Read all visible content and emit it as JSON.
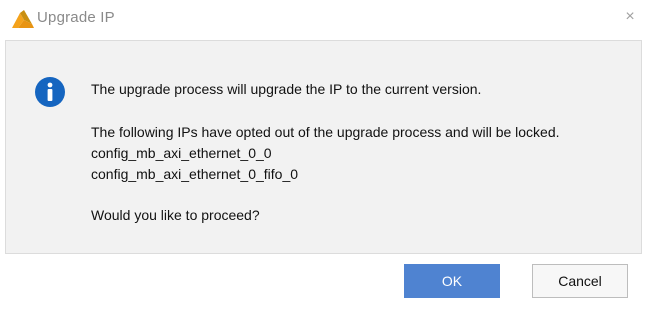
{
  "window": {
    "title": "Upgrade IP",
    "icon": "xilinx-logo-icon",
    "close_glyph": "×"
  },
  "message": {
    "icon": "info-icon",
    "line1": "The upgrade process will upgrade the IP to the current version.",
    "line2": "The following IPs have opted out of the upgrade process and will be locked.",
    "locked_ips": [
      "config_mb_axi_ethernet_0_0",
      "config_mb_axi_ethernet_0_fifo_0"
    ],
    "question": "Would you like to proceed?"
  },
  "buttons": {
    "ok_label": "OK",
    "cancel_label": "Cancel"
  },
  "colors": {
    "accent": "#4f83d1",
    "info_icon": "#1565c0",
    "logo_orange": "#f4a21b",
    "logo_gold": "#c98f10"
  }
}
